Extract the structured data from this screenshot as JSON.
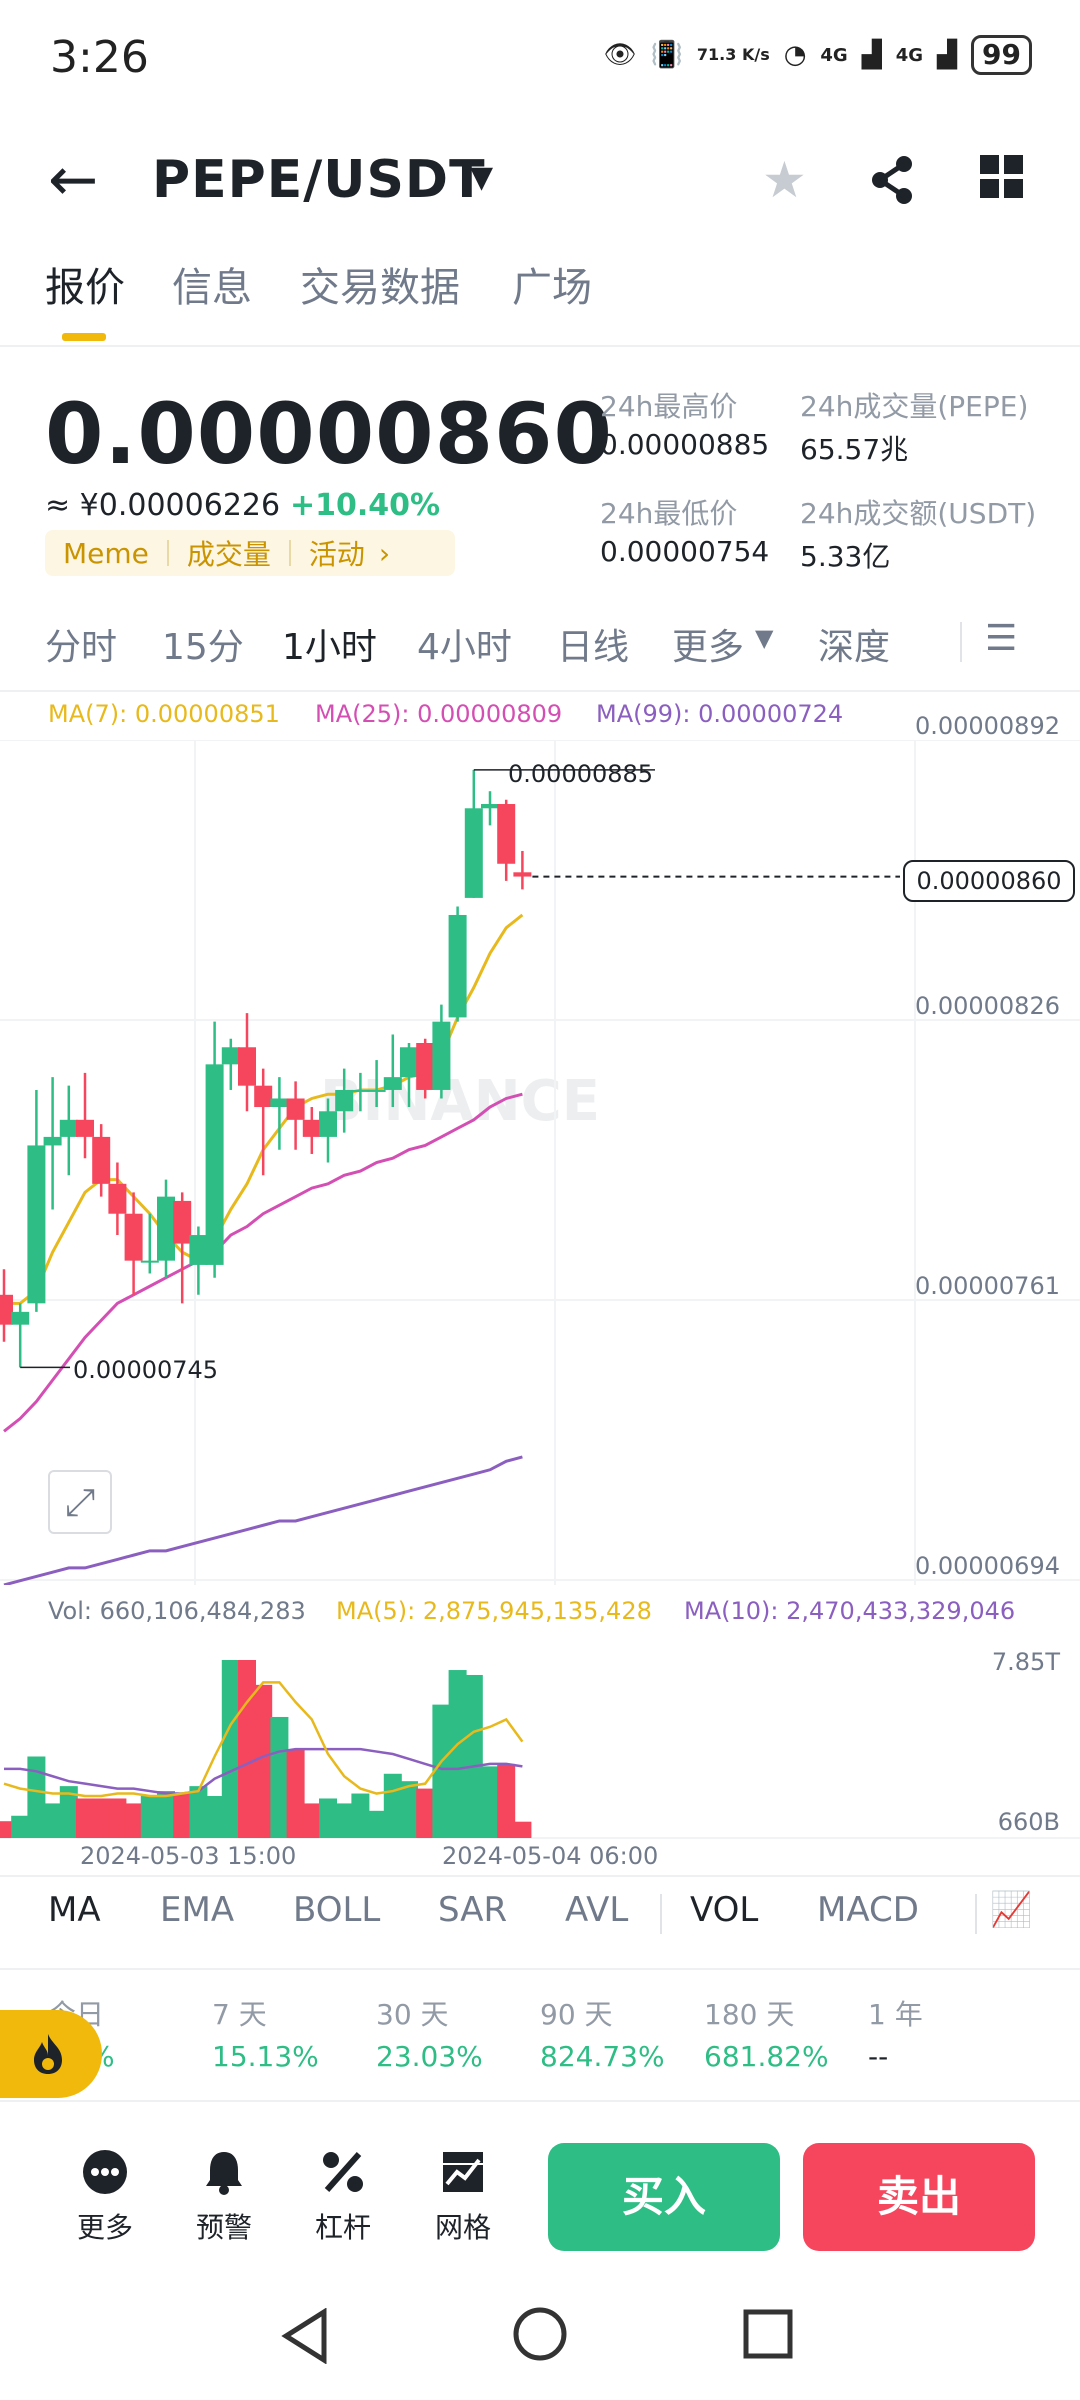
{
  "status_bar": {
    "time": "3:26",
    "speed": "71.3 K/s",
    "net1": "4G",
    "net2": "4G",
    "battery": "99"
  },
  "header": {
    "pair": "PEPE/USDT"
  },
  "tabs": [
    "报价",
    "信息",
    "交易数据",
    "广场"
  ],
  "ticker": {
    "price": "0.00000860",
    "cny": "≈ ¥0.00006226",
    "change": "+10.40%",
    "tags": [
      "Meme",
      "成交量",
      "活动"
    ],
    "high_label": "24h最高价",
    "high": "0.00000885",
    "low_label": "24h最低价",
    "low": "0.00000754",
    "vol_base_label": "24h成交量(PEPE)",
    "vol_base": "65.57兆",
    "vol_quote_label": "24h成交额(USDT)",
    "vol_quote": "5.33亿"
  },
  "intervals": [
    "分时",
    "15分",
    "1小时",
    "4小时",
    "日线",
    "更多",
    "深度"
  ],
  "ma": {
    "ma7": "MA(7): 0.00000851",
    "ma25": "MA(25): 0.00000809",
    "ma99": "MA(99): 0.00000724"
  },
  "price_axis": [
    "0.00000892",
    "0.00000826",
    "0.00000761",
    "0.00000694"
  ],
  "last_price_tag": "0.00000860",
  "max_marker": "0.00000885",
  "min_marker": "0.00000745",
  "watermark": "BINANCE",
  "vol": {
    "vol": "Vol: 660,106,484,283",
    "ma5": "MA(5): 2,875,945,135,428",
    "ma10": "MA(10): 2,470,433,329,046",
    "axis_top": "7.85T",
    "axis_bottom": "660B"
  },
  "time_axis": [
    "2024-05-03 15:00",
    "2024-05-04 06:00"
  ],
  "indicators": [
    "MA",
    "EMA",
    "BOLL",
    "SAR",
    "AVL",
    "VOL",
    "MACD"
  ],
  "performance": [
    {
      "label": "今日",
      "value": "%"
    },
    {
      "label": "7 天",
      "value": "15.13%"
    },
    {
      "label": "30 天",
      "value": "23.03%"
    },
    {
      "label": "90 天",
      "value": "824.73%"
    },
    {
      "label": "180 天",
      "value": "681.82%"
    },
    {
      "label": "1 年",
      "value": "--"
    }
  ],
  "bottom_actions": [
    "更多",
    "预警",
    "杠杆",
    "网格"
  ],
  "buy_label": "买入",
  "sell_label": "卖出",
  "colors": {
    "up": "#2ebd85",
    "down": "#f6465d",
    "ma7": "#e8b91c",
    "ma25": "#d44fb3",
    "ma99": "#8b5fbf",
    "accent": "#f0b90b"
  },
  "chart_data": {
    "type": "candlestick",
    "interval": "1小时",
    "candles": [
      {
        "o": 7.62e-06,
        "h": 7.68e-06,
        "l": 7.51e-06,
        "c": 7.55e-06
      },
      {
        "o": 7.55e-06,
        "h": 7.6e-06,
        "l": 7.45e-06,
        "c": 7.58e-06
      },
      {
        "o": 7.6e-06,
        "h": 8.1e-06,
        "l": 7.58e-06,
        "c": 7.97e-06
      },
      {
        "o": 7.97e-06,
        "h": 8.13e-06,
        "l": 7.82e-06,
        "c": 7.99e-06
      },
      {
        "o": 7.99e-06,
        "h": 8.11e-06,
        "l": 7.9e-06,
        "c": 8.03e-06
      },
      {
        "o": 8.03e-06,
        "h": 8.14e-06,
        "l": 7.94e-06,
        "c": 7.99e-06
      },
      {
        "o": 7.99e-06,
        "h": 8.02e-06,
        "l": 7.85e-06,
        "c": 7.88e-06
      },
      {
        "o": 7.88e-06,
        "h": 7.93e-06,
        "l": 7.76e-06,
        "c": 7.81e-06
      },
      {
        "o": 7.81e-06,
        "h": 7.86e-06,
        "l": 7.62e-06,
        "c": 7.7e-06
      },
      {
        "o": 7.7e-06,
        "h": 7.81e-06,
        "l": 7.67e-06,
        "c": 7.7e-06
      },
      {
        "o": 7.7e-06,
        "h": 7.89e-06,
        "l": 7.66e-06,
        "c": 7.85e-06
      },
      {
        "o": 7.84e-06,
        "h": 7.86e-06,
        "l": 7.6e-06,
        "c": 7.74e-06
      },
      {
        "o": 7.69e-06,
        "h": 7.78e-06,
        "l": 7.62e-06,
        "c": 7.76e-06
      },
      {
        "o": 7.69e-06,
        "h": 8.26e-06,
        "l": 7.66e-06,
        "c": 8.16e-06
      },
      {
        "o": 8.16e-06,
        "h": 8.22e-06,
        "l": 8.1e-06,
        "c": 8.2e-06
      },
      {
        "o": 8.2e-06,
        "h": 8.28e-06,
        "l": 8.05e-06,
        "c": 8.11e-06
      },
      {
        "o": 8.11e-06,
        "h": 8.15e-06,
        "l": 7.9e-06,
        "c": 8.06e-06
      },
      {
        "o": 8.06e-06,
        "h": 8.13e-06,
        "l": 7.96e-06,
        "c": 8.08e-06
      },
      {
        "o": 8.08e-06,
        "h": 8.12e-06,
        "l": 7.96e-06,
        "c": 8.03e-06
      },
      {
        "o": 8.03e-06,
        "h": 8.06e-06,
        "l": 7.95e-06,
        "c": 7.99e-06
      },
      {
        "o": 7.99e-06,
        "h": 8.08e-06,
        "l": 7.93e-06,
        "c": 8.05e-06
      },
      {
        "o": 8.05e-06,
        "h": 8.15e-06,
        "l": 8e-06,
        "c": 8.1e-06
      },
      {
        "o": 8.1e-06,
        "h": 8.14e-06,
        "l": 8.05e-06,
        "c": 8.1e-06
      },
      {
        "o": 8.1e-06,
        "h": 8.17e-06,
        "l": 8.06e-06,
        "c": 8.1e-06
      },
      {
        "o": 8.1e-06,
        "h": 8.23e-06,
        "l": 8.06e-06,
        "c": 8.13e-06
      },
      {
        "o": 8.13e-06,
        "h": 8.21e-06,
        "l": 8.06e-06,
        "c": 8.2e-06
      },
      {
        "o": 8.21e-06,
        "h": 8.22e-06,
        "l": 8.08e-06,
        "c": 8.1e-06
      },
      {
        "o": 8.1e-06,
        "h": 8.3e-06,
        "l": 8.08e-06,
        "c": 8.26e-06
      },
      {
        "o": 8.27e-06,
        "h": 8.53e-06,
        "l": 8.26e-06,
        "c": 8.51e-06
      },
      {
        "o": 8.55e-06,
        "h": 8.85e-06,
        "l": 8.55e-06,
        "c": 8.76e-06
      },
      {
        "o": 8.76e-06,
        "h": 8.8e-06,
        "l": 8.72e-06,
        "c": 8.77e-06
      },
      {
        "o": 8.77e-06,
        "h": 8.78e-06,
        "l": 8.59e-06,
        "c": 8.63e-06
      },
      {
        "o": 8.61e-06,
        "h": 8.66e-06,
        "l": 8.57e-06,
        "c": 8.6e-06
      }
    ],
    "ma7": [
      7.6e-06,
      7.6e-06,
      7.63e-06,
      7.72e-06,
      7.79e-06,
      7.86e-06,
      7.89e-06,
      7.89e-06,
      7.85e-06,
      7.81e-06,
      7.76e-06,
      7.72e-06,
      7.7e-06,
      7.75e-06,
      7.82e-06,
      7.88e-06,
      7.96e-06,
      8.01e-06,
      8.06e-06,
      8.08e-06,
      8.09e-06,
      8.09e-06,
      8.1e-06,
      8.1e-06,
      8.11e-06,
      8.13e-06,
      8.14e-06,
      8.18e-06,
      8.27e-06,
      8.34e-06,
      8.42e-06,
      8.48e-06,
      8.51e-06
    ],
    "ma25": [
      7.3e-06,
      7.33e-06,
      7.37e-06,
      7.42e-06,
      7.47e-06,
      7.52e-06,
      7.56e-06,
      7.6e-06,
      7.62e-06,
      7.64e-06,
      7.66e-06,
      7.68e-06,
      7.7e-06,
      7.72e-06,
      7.76e-06,
      7.78e-06,
      7.81e-06,
      7.83e-06,
      7.85e-06,
      7.87e-06,
      7.88e-06,
      7.9e-06,
      7.91e-06,
      7.93e-06,
      7.94e-06,
      7.96e-06,
      7.97e-06,
      7.99e-06,
      8.01e-06,
      8.03e-06,
      8.06e-06,
      8.08e-06,
      8.09e-06
    ],
    "ma99": [
      6.94e-06,
      6.95e-06,
      6.96e-06,
      6.97e-06,
      6.98e-06,
      6.98e-06,
      6.99e-06,
      7e-06,
      7.01e-06,
      7.02e-06,
      7.02e-06,
      7.03e-06,
      7.04e-06,
      7.05e-06,
      7.06e-06,
      7.07e-06,
      7.08e-06,
      7.09e-06,
      7.09e-06,
      7.1e-06,
      7.11e-06,
      7.12e-06,
      7.13e-06,
      7.14e-06,
      7.15e-06,
      7.16e-06,
      7.17e-06,
      7.18e-06,
      7.19e-06,
      7.2e-06,
      7.21e-06,
      7.23e-06,
      7.24e-06
    ],
    "ylim": [
      6.94e-06,
      8.92e-06
    ],
    "volume": [
      0.68,
      0.9,
      3.3,
      1.4,
      2.1,
      1.6,
      1.6,
      1.6,
      1.4,
      1.7,
      1.9,
      1.8,
      2.1,
      1.7,
      9.3,
      8.6,
      6.2,
      4.9,
      3.6,
      1.4,
      1.6,
      1.4,
      1.8,
      1.1,
      2.6,
      2.3,
      2.0,
      5.4,
      6.8,
      6.6,
      2.9,
      3.0,
      0.66
    ],
    "volume_units": "T",
    "vol_ma5": [
      2.2,
      2.0,
      1.9,
      1.8,
      1.8,
      1.7,
      1.7,
      1.8,
      1.8,
      1.7,
      1.7,
      1.8,
      1.9,
      3.3,
      4.6,
      5.5,
      6.3,
      6.3,
      5.5,
      4.8,
      3.4,
      2.5,
      2.0,
      1.8,
      1.9,
      2.1,
      2.2,
      3.1,
      3.8,
      4.3,
      4.5,
      4.8,
      3.9
    ],
    "vol_ma10": [
      2.8,
      2.8,
      2.7,
      2.5,
      2.3,
      2.2,
      2.1,
      2.0,
      2.0,
      1.9,
      1.8,
      1.8,
      1.9,
      2.4,
      2.7,
      3.0,
      3.3,
      3.5,
      3.6,
      3.6,
      3.6,
      3.6,
      3.6,
      3.5,
      3.4,
      3.2,
      3.0,
      2.8,
      2.8,
      2.9,
      3.0,
      3.0,
      2.9
    ],
    "vol_ylim": [
      0,
      10
    ]
  }
}
